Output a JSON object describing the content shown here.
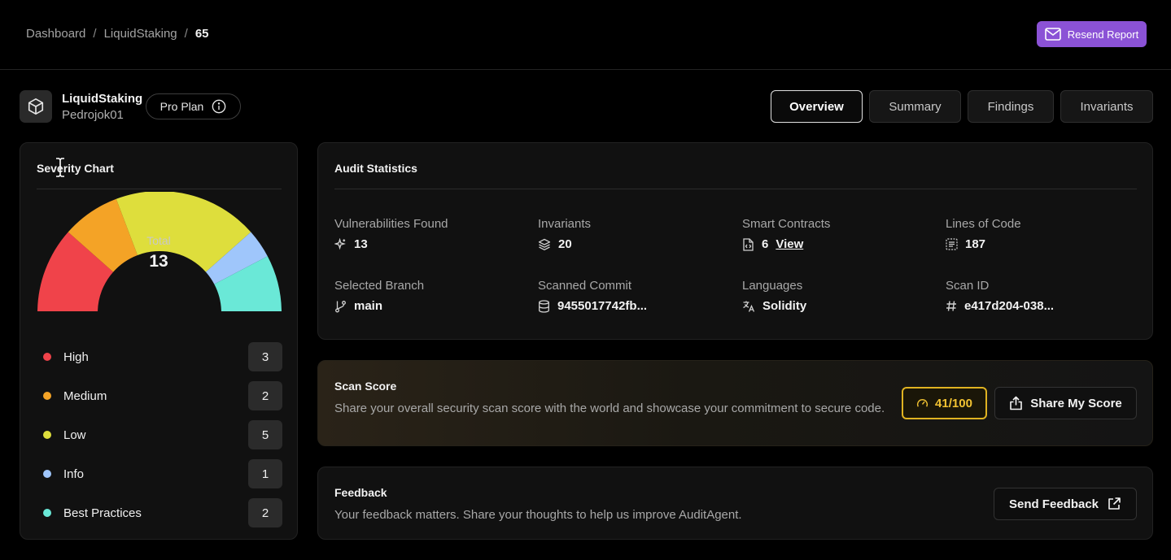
{
  "breadcrumb": {
    "items": [
      "Dashboard",
      "LiquidStaking"
    ],
    "separator": "/",
    "current": "65"
  },
  "header": {
    "resend_label": "Resend Report"
  },
  "project": {
    "name": "LiquidStaking",
    "owner": "Pedrojok01",
    "plan": "Pro Plan"
  },
  "tabs": [
    {
      "label": "Overview",
      "active": true
    },
    {
      "label": "Summary",
      "active": false
    },
    {
      "label": "Findings",
      "active": false
    },
    {
      "label": "Invariants",
      "active": false
    }
  ],
  "severity": {
    "title": "Severity Chart",
    "total_label": "Total",
    "total_value": "13",
    "items": [
      {
        "name": "High",
        "count": "3",
        "color": "#f0434a"
      },
      {
        "name": "Medium",
        "count": "2",
        "color": "#f4a326"
      },
      {
        "name": "Low",
        "count": "5",
        "color": "#dede3c"
      },
      {
        "name": "Info",
        "count": "1",
        "color": "#9fc6fb"
      },
      {
        "name": "Best Practices",
        "count": "2",
        "color": "#6ae8d7"
      }
    ]
  },
  "chart_data": {
    "type": "pie",
    "variant": "half-donut",
    "categories": [
      "High",
      "Medium",
      "Low",
      "Info",
      "Best Practices"
    ],
    "values": [
      3,
      2,
      5,
      1,
      2
    ],
    "colors": [
      "#f0434a",
      "#f4a326",
      "#dede3c",
      "#9fc6fb",
      "#6ae8d7"
    ],
    "title": "Severity Chart"
  },
  "audit": {
    "title": "Audit Statistics",
    "stats": [
      {
        "label": "Vulnerabilities Found",
        "value": "13",
        "icon": "sparkles-icon"
      },
      {
        "label": "Invariants",
        "value": "20",
        "icon": "layers-icon"
      },
      {
        "label": "Smart Contracts",
        "value": "6",
        "link": "View",
        "icon": "file-code-icon"
      },
      {
        "label": "Lines of Code",
        "value": "187",
        "icon": "code-lines-icon"
      },
      {
        "label": "Selected Branch",
        "value": "main",
        "icon": "git-branch-icon"
      },
      {
        "label": "Scanned Commit",
        "value": "9455017742fb...",
        "icon": "database-icon"
      },
      {
        "label": "Languages",
        "value": "Solidity",
        "icon": "translate-icon"
      },
      {
        "label": "Scan ID",
        "value": "e417d204-038...",
        "icon": "hash-icon"
      }
    ]
  },
  "scan_score": {
    "title": "Scan Score",
    "description": "Share your overall security scan score with the world and showcase your commitment to secure code.",
    "score": "41/100",
    "share_label": "Share My Score"
  },
  "feedback": {
    "title": "Feedback",
    "description": "Your feedback matters. Share your thoughts to help us improve AuditAgent.",
    "button_label": "Send Feedback"
  }
}
